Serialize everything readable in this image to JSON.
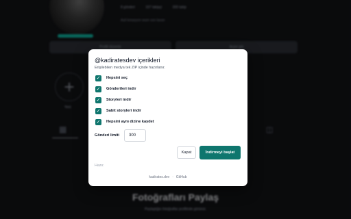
{
  "profile": {
    "stats": [
      "8 gönderi",
      "107 takipçi",
      "300 takip"
    ],
    "bio": "Asil kreasyon wum son lavan",
    "buttons": [
      "Profili düzenle",
      "Arşivi gör"
    ],
    "new_label": "Yeni",
    "empty_title": "Fotoğrafları Paylaş",
    "empty_subtitle": "Paylaştığın fotoğraflar profilinde görünür."
  },
  "modal": {
    "title": "@kadiratesdev içerikleri",
    "subtitle": "Erişilebilen medya tek ZIP içinde hazırlanır.",
    "options": [
      {
        "label": "Hepsini seç",
        "checked": true
      },
      {
        "label": "Gönderileri indir",
        "checked": true
      },
      {
        "label": "Storyleri indir",
        "checked": true
      },
      {
        "label": "Sabit storyleri indir",
        "checked": true
      },
      {
        "label": "Hepsini aynı dizine kaydet",
        "checked": true
      }
    ],
    "limit_label": "Gönderi limiti",
    "limit_value": "300",
    "close_label": "Kapat",
    "start_label": "İndirmeyi başlat",
    "status": "Hazır.",
    "footer_site": "kadirates.dev",
    "footer_sep": "·",
    "footer_repo": "GitHub"
  },
  "colors": {
    "accent": "#0f766e",
    "background": "#121316"
  },
  "icons": {
    "checkbox": "check-icon",
    "plus": "plus-icon",
    "grid": "grid-icon",
    "tagged": "tag-icon"
  }
}
